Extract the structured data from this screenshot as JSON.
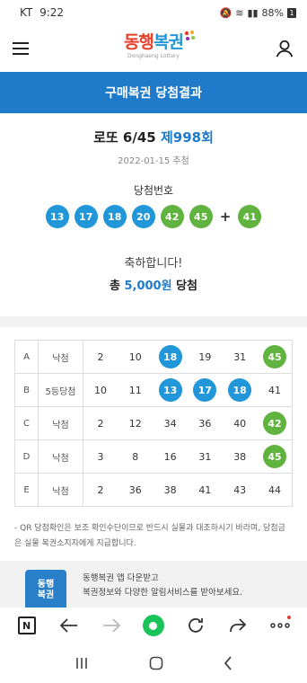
{
  "status": {
    "carrier": "KT",
    "time": "9:22",
    "battery": "88%"
  },
  "header": {
    "logo_text_1": "동행",
    "logo_text_2": "복권",
    "logo_sub": "Donghaeng Lottery"
  },
  "page_title": "구매복권 당첨결과",
  "result": {
    "game": "로또 6/45",
    "round": "제998회",
    "draw_date": "2022-01-15 추첨",
    "win_label": "당첨번호",
    "numbers": [
      13,
      17,
      18,
      20,
      42,
      45
    ],
    "number_colors": [
      "blue",
      "blue",
      "blue",
      "blue",
      "green",
      "green"
    ],
    "bonus": 41,
    "bonus_color": "green",
    "plus": "+"
  },
  "congrats": {
    "line1": "축하합니다!",
    "prefix": "총",
    "amount": "5,000원",
    "suffix": "당첨"
  },
  "tickets": [
    {
      "slot": "A",
      "result": "낙첨",
      "numbers": [
        2,
        10,
        18,
        19,
        31,
        45
      ],
      "hits": [
        "",
        "",
        "blue",
        "",
        "",
        "green"
      ]
    },
    {
      "slot": "B",
      "result": "5등당첨",
      "numbers": [
        10,
        11,
        13,
        17,
        18,
        41
      ],
      "hits": [
        "",
        "",
        "blue",
        "blue",
        "blue",
        ""
      ]
    },
    {
      "slot": "C",
      "result": "낙첨",
      "numbers": [
        2,
        12,
        34,
        36,
        40,
        42
      ],
      "hits": [
        "",
        "",
        "",
        "",
        "",
        "green"
      ]
    },
    {
      "slot": "D",
      "result": "낙첨",
      "numbers": [
        3,
        8,
        16,
        31,
        38,
        45
      ],
      "hits": [
        "",
        "",
        "",
        "",
        "",
        "green"
      ]
    },
    {
      "slot": "E",
      "result": "낙첨",
      "numbers": [
        2,
        36,
        38,
        41,
        43,
        44
      ],
      "hits": [
        "",
        "",
        "",
        "",
        "",
        ""
      ]
    }
  ],
  "notice": "- QR 당첨확인은 보조 확인수단이므로 반드시 실물과 대조하시기 바라며, 당첨금은 실물 복권소지자에게 지급합니다.",
  "promo": {
    "icon_text": "동행\n복권",
    "line1": "동행복권 앱 다운받고",
    "line2": "복권정보와 다양한 알림서비스를 받아보세요."
  },
  "colors": {
    "primary": "#1f7ac9",
    "ball_blue": "#2196d8",
    "ball_green": "#5fb33e"
  }
}
